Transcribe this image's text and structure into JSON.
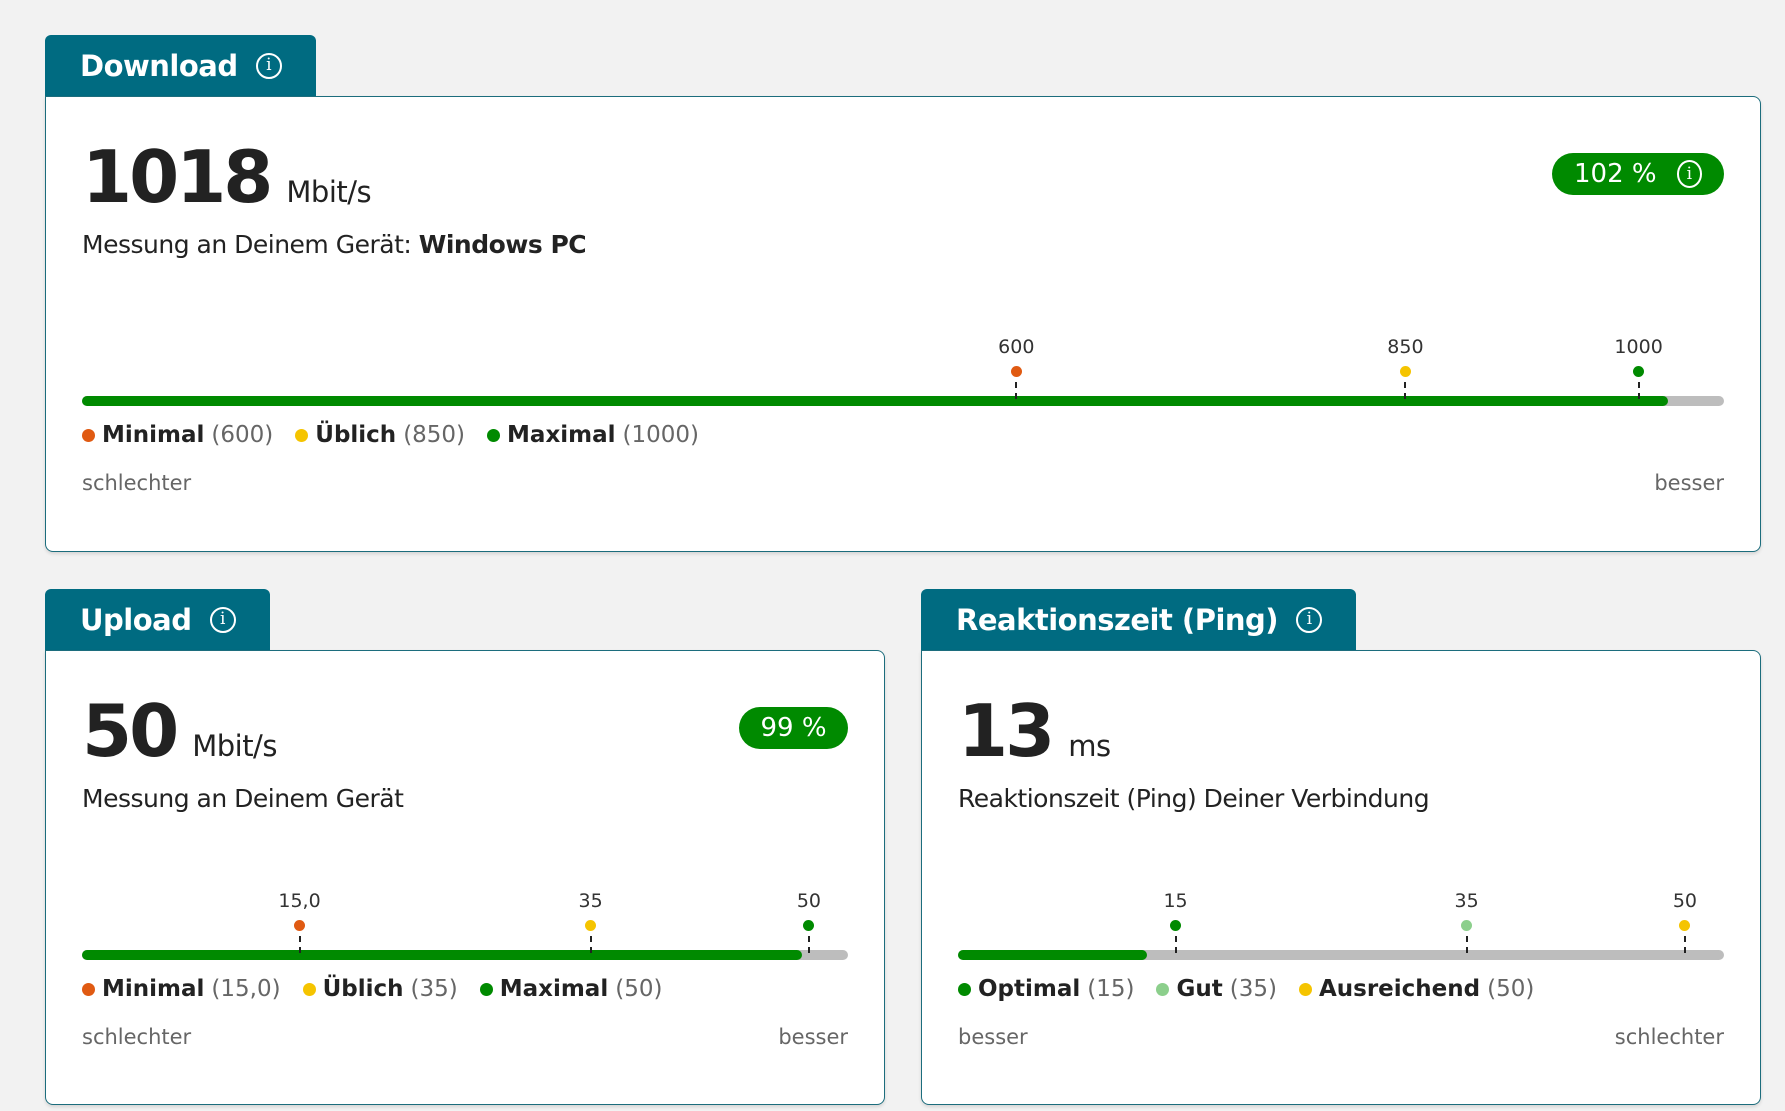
{
  "download": {
    "title": "Download",
    "value": "1018",
    "unit": "Mbit/s",
    "subtitle_prefix": "Messung an Deinem Gerät: ",
    "device": "Windows PC",
    "badge": "102  %",
    "progress_fraction": 0.966,
    "markers": [
      {
        "label": "600",
        "color": "#e05a12",
        "position_fraction": 0.569
      },
      {
        "label": "850",
        "color": "#f5c400",
        "position_fraction": 0.806
      },
      {
        "label": "1000",
        "color": "#008a00",
        "position_fraction": 0.948
      }
    ],
    "legend": [
      {
        "name": "Minimal",
        "value": "(600)",
        "color": "#e05a12"
      },
      {
        "name": "Üblich",
        "value": "(850)",
        "color": "#f5c400"
      },
      {
        "name": "Maximal",
        "value": "(1000)",
        "color": "#008a00"
      }
    ],
    "scale_left": "schlechter",
    "scale_right": "besser"
  },
  "upload": {
    "title": "Upload",
    "value": "50",
    "unit": "Mbit/s",
    "subtitle": "Messung an Deinem Gerät",
    "badge": "99  %",
    "progress_fraction": 0.94,
    "markers": [
      {
        "label": "15,0",
        "color": "#e05a12",
        "position_fraction": 0.284
      },
      {
        "label": "35",
        "color": "#f5c400",
        "position_fraction": 0.664
      },
      {
        "label": "50",
        "color": "#008a00",
        "position_fraction": 0.949
      }
    ],
    "legend": [
      {
        "name": "Minimal",
        "value": "(15,0)",
        "color": "#e05a12"
      },
      {
        "name": "Üblich",
        "value": "(35)",
        "color": "#f5c400"
      },
      {
        "name": "Maximal",
        "value": "(50)",
        "color": "#008a00"
      }
    ],
    "scale_left": "schlechter",
    "scale_right": "besser"
  },
  "ping": {
    "title": "Reaktionszeit (Ping)",
    "value": "13",
    "unit": "ms",
    "subtitle": "Reaktionszeit (Ping) Deiner Verbindung",
    "progress_fraction": 0.247,
    "markers": [
      {
        "label": "15",
        "color": "#008a00",
        "position_fraction": 0.284
      },
      {
        "label": "35",
        "color": "#8ccf8c",
        "position_fraction": 0.664
      },
      {
        "label": "50",
        "color": "#f5c400",
        "position_fraction": 0.949
      }
    ],
    "legend": [
      {
        "name": "Optimal",
        "value": "(15)",
        "color": "#008a00"
      },
      {
        "name": "Gut",
        "value": "(35)",
        "color": "#8ccf8c"
      },
      {
        "name": "Ausreichend",
        "value": "(50)",
        "color": "#f5c400"
      }
    ],
    "scale_left": "besser",
    "scale_right": "schlechter"
  }
}
